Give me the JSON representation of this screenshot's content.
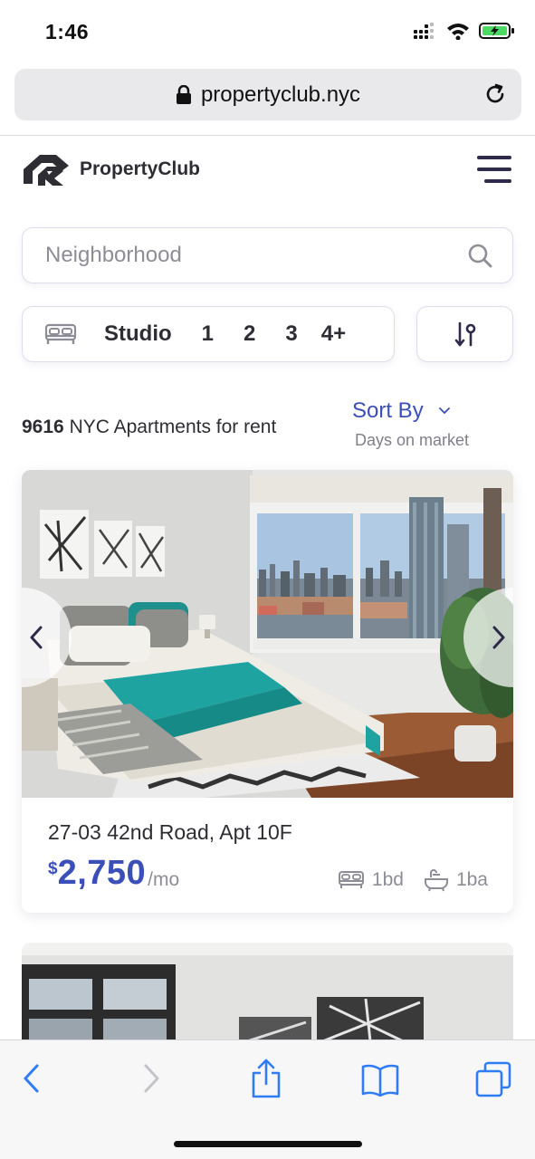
{
  "status_bar": {
    "time": "1:46"
  },
  "browser": {
    "url": "propertyclub.nyc"
  },
  "header": {
    "logo_text": "PropertyClub"
  },
  "search": {
    "placeholder": "Neighborhood"
  },
  "bed_filter": {
    "options": [
      "Studio",
      "1",
      "2",
      "3",
      "4+"
    ]
  },
  "results": {
    "count": "9616",
    "label": "NYC Apartments for rent",
    "sort_label": "Sort By",
    "sort_value": "Days on market"
  },
  "listings": [
    {
      "address": "27-03 42nd Road, Apt 10F",
      "currency": "$",
      "price": "2,750",
      "price_unit": "/mo",
      "beds": "1bd",
      "baths": "1ba"
    }
  ],
  "colors": {
    "accent": "#3b4fb8",
    "safari_blue": "#2f7cf6",
    "teal": "#1fa3a0"
  },
  "icons": {
    "lock": "lock-icon",
    "reload": "reload-icon",
    "search": "search-icon",
    "bed": "bed-icon",
    "filter": "filter-icon",
    "bath": "bath-icon"
  }
}
